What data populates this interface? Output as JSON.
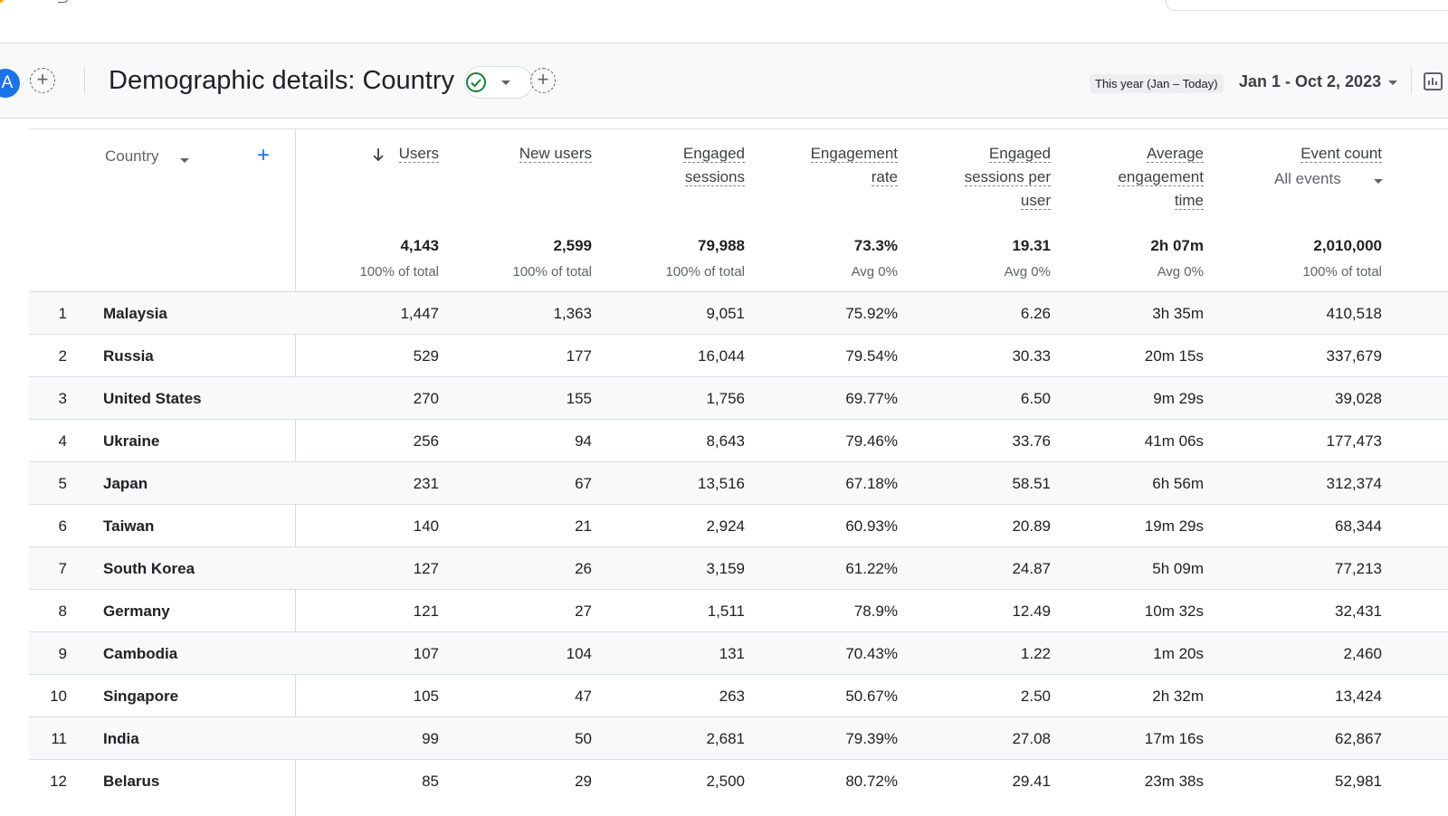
{
  "header": {
    "avatar_letter": "A",
    "title": "Demographic details: Country",
    "date_preset": "This year (Jan – Today)",
    "date_range": "Jan 1 - Oct 2, 2023"
  },
  "table": {
    "dimension_label": "Country",
    "metric_columns": [
      {
        "label_lines": [
          "Users"
        ],
        "sorted": true,
        "total": "4,143",
        "sub": "100% of total"
      },
      {
        "label_lines": [
          "New users"
        ],
        "total": "2,599",
        "sub": "100% of total"
      },
      {
        "label_lines": [
          "Engaged",
          "sessions"
        ],
        "total": "79,988",
        "sub": "100% of total"
      },
      {
        "label_lines": [
          "Engagement",
          "rate"
        ],
        "total": "73.3%",
        "sub": "Avg 0%"
      },
      {
        "label_lines": [
          "Engaged",
          "sessions per",
          "user"
        ],
        "total": "19.31",
        "sub": "Avg 0%"
      },
      {
        "label_lines": [
          "Average",
          "engagement",
          "time"
        ],
        "total": "2h 07m",
        "sub": "Avg 0%"
      },
      {
        "label_lines": [
          "Event count"
        ],
        "selector": "All events",
        "total": "2,010,000",
        "sub": "100% of total"
      }
    ],
    "rows": [
      {
        "index": "1",
        "country": "Malaysia",
        "values": [
          "1,447",
          "1,363",
          "9,051",
          "75.92%",
          "6.26",
          "3h 35m",
          "410,518"
        ]
      },
      {
        "index": "2",
        "country": "Russia",
        "values": [
          "529",
          "177",
          "16,044",
          "79.54%",
          "30.33",
          "20m 15s",
          "337,679"
        ]
      },
      {
        "index": "3",
        "country": "United States",
        "values": [
          "270",
          "155",
          "1,756",
          "69.77%",
          "6.50",
          "9m 29s",
          "39,028"
        ]
      },
      {
        "index": "4",
        "country": "Ukraine",
        "values": [
          "256",
          "94",
          "8,643",
          "79.46%",
          "33.76",
          "41m 06s",
          "177,473"
        ]
      },
      {
        "index": "5",
        "country": "Japan",
        "values": [
          "231",
          "67",
          "13,516",
          "67.18%",
          "58.51",
          "6h 56m",
          "312,374"
        ]
      },
      {
        "index": "6",
        "country": "Taiwan",
        "values": [
          "140",
          "21",
          "2,924",
          "60.93%",
          "20.89",
          "19m 29s",
          "68,344"
        ]
      },
      {
        "index": "7",
        "country": "South Korea",
        "values": [
          "127",
          "26",
          "3,159",
          "61.22%",
          "24.87",
          "5h 09m",
          "77,213"
        ]
      },
      {
        "index": "8",
        "country": "Germany",
        "values": [
          "121",
          "27",
          "1,511",
          "78.9%",
          "12.49",
          "10m 32s",
          "32,431"
        ]
      },
      {
        "index": "9",
        "country": "Cambodia",
        "values": [
          "107",
          "104",
          "131",
          "70.43%",
          "1.22",
          "1m 20s",
          "2,460"
        ]
      },
      {
        "index": "10",
        "country": "Singapore",
        "values": [
          "105",
          "47",
          "263",
          "50.67%",
          "2.50",
          "2h 32m",
          "13,424"
        ]
      },
      {
        "index": "11",
        "country": "India",
        "values": [
          "99",
          "50",
          "2,681",
          "79.39%",
          "27.08",
          "17m 16s",
          "62,867"
        ]
      },
      {
        "index": "12",
        "country": "Belarus",
        "values": [
          "85",
          "29",
          "2,500",
          "80.72%",
          "29.41",
          "23m 38s",
          "52,981"
        ]
      }
    ]
  },
  "colors": {
    "accent_blue": "#1a73e8",
    "success_green": "#188038",
    "row_shade": "#f8f9fa",
    "border": "#dadce0"
  }
}
